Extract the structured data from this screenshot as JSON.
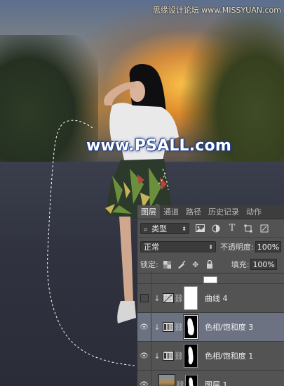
{
  "watermarks": {
    "top": "思缘设计论坛 www.MISSYUAN.com",
    "center": "www.PSALL.com"
  },
  "panel": {
    "tabs": [
      {
        "label": "图层",
        "active": true
      },
      {
        "label": "通道",
        "active": false
      },
      {
        "label": "路径",
        "active": false
      },
      {
        "label": "历史记录",
        "active": false
      },
      {
        "label": "动作",
        "active": false
      }
    ],
    "filter": {
      "value": "类型"
    },
    "blend_mode": "正常",
    "opacity_label": "不透明度:",
    "opacity_value": "100%",
    "lock_label": "锁定:",
    "fill_label": "填充:",
    "fill_value": "100%",
    "layers": [
      {
        "name": "",
        "visible": false,
        "partial": true
      },
      {
        "name": "曲线 4",
        "visible": false,
        "type": "curves"
      },
      {
        "name": "色相/饱和度 3",
        "visible": true,
        "type": "hue-saturation",
        "selected": true
      },
      {
        "name": "色相/饱和度 1",
        "visible": true,
        "type": "hue-saturation"
      },
      {
        "name": "图层 1",
        "visible": true,
        "type": "pixel"
      }
    ]
  },
  "colors": {
    "panel_bg": "#535353",
    "tabbar_bg": "#3d3d3d",
    "selected_row": "#6c7282",
    "watermark_outline": "#1a3a88"
  }
}
